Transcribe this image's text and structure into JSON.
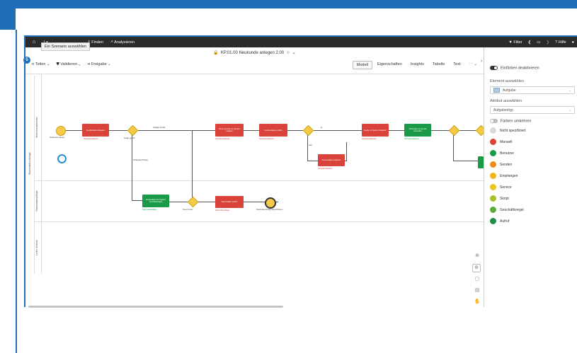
{
  "topbar": {
    "home_icon": "home-icon",
    "items": [
      "Le",
      "Finden",
      "Analysieren"
    ],
    "tooltip": "Ein Szenario auswählen",
    "right_items": [
      "Filter",
      "Hilfe"
    ]
  },
  "title": "KP.01.00 Neukunde anlegen 2.00",
  "badge": "5",
  "toolbar": {
    "left": [
      "Teilen",
      "Validieren",
      "Freigabe"
    ],
    "tabs": [
      "Modell",
      "Eigenschaften",
      "Insights",
      "Tabelle",
      "Text"
    ],
    "active_tab": "Modell"
  },
  "diagram": {
    "pool": "Stammdaten-Anlage",
    "lanes": [
      "Vertriebsmitarbeiter",
      "Stammdatenpflege",
      "Leiter Vertrieb"
    ],
    "flow_labels": [
      "Gültiger Kunde",
      "Neuer Kunde",
      "Fehlende Prüfung",
      "ja",
      "nein"
    ],
    "event_labels": [
      "Neukunden anlegen",
      "Anlage geprüft",
      "Stammdatenanlage abgeschlossen"
    ],
    "tasks": [
      {
        "label": "Kundendaten erfassen",
        "color": "#d9433a",
        "role": "Vertriebsmitarbeiter"
      },
      {
        "label": "Neuen Kunden im System anlegen",
        "color": "#d9433a",
        "role": "Vertriebsmitarbeiter"
      },
      {
        "label": "Kunde anlegen prüfen",
        "color": "#d9433a",
        "role": "Vertriebsmitarbeiter"
      },
      {
        "label": "Kundendaten ergänzen",
        "color": "#d9433a",
        "role": "Vertriebsmitarbeiter"
      },
      {
        "label": "Kunde im System freigeben",
        "color": "#d9433a",
        "role": "Vertriebsmitarbeiter"
      },
      {
        "label": "Information an Kunde versenden",
        "color": "#1a9a47",
        "role": "Vertriebsmitarbeiter"
      },
      {
        "label": "Kundendaten im System vervollständigen",
        "color": "#1a9a47",
        "role": "Stammdatenpflege"
      },
      {
        "label": "Stammdaten prüfen",
        "color": "#d9433a",
        "role": "Stammdatenpflege"
      }
    ]
  },
  "panel": {
    "toggle_label": "Einfärben deaktivieren",
    "element_label": "Element auswählen",
    "element_value": "Aufgabe",
    "attribute_label": "Attribut auswählen",
    "attribute_value": "Aufgabentyp",
    "colors_toggle": "Farben umkehren",
    "legend": [
      {
        "label": "Nicht spezifiziert",
        "color": "#d9d9d9"
      },
      {
        "label": "Manuell",
        "color": "#d9433a"
      },
      {
        "label": "Benutzer",
        "color": "#1a9a47"
      },
      {
        "label": "Senden",
        "color": "#f08c1a"
      },
      {
        "label": "Empfangen",
        "color": "#f2b21b"
      },
      {
        "label": "Service",
        "color": "#e8c71c"
      },
      {
        "label": "Skript",
        "color": "#a8c229"
      },
      {
        "label": "Geschäftsregel",
        "color": "#5daa3a"
      },
      {
        "label": "Aufruf",
        "color": "#1e8f47"
      }
    ]
  }
}
